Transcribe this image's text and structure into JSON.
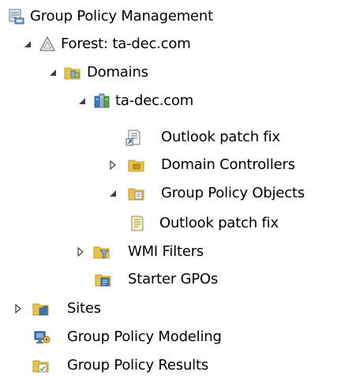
{
  "tree": {
    "root": {
      "label": "Group Policy Management"
    },
    "forest": {
      "label": "Forest: ta-dec.com"
    },
    "domains": {
      "label": "Domains"
    },
    "domain": {
      "label": "ta-dec.com"
    },
    "gpo_link": {
      "label": "Outlook patch fix"
    },
    "domain_controllers": {
      "label": "Domain Controllers"
    },
    "gpo_container": {
      "label": "Group Policy Objects"
    },
    "gpo_item": {
      "label": "Outlook patch fix"
    },
    "wmi_filters": {
      "label": "WMI Filters"
    },
    "starter_gpos": {
      "label": "Starter GPOs"
    },
    "sites": {
      "label": "Sites"
    },
    "modeling": {
      "label": "Group Policy Modeling"
    },
    "results": {
      "label": "Group Policy Results"
    }
  },
  "colors": {
    "folder": "#e8c34a",
    "folder_dark": "#c79a1e",
    "arrow": "#404040",
    "server_blue": "#3a78c2",
    "server_green": "#5aa03a"
  }
}
